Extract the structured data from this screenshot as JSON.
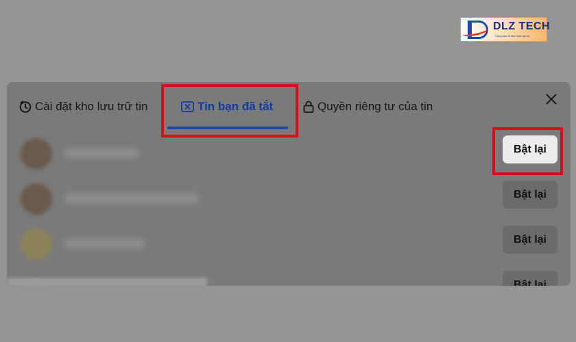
{
  "watermark": {
    "name": "DLZ TECH",
    "tagline": "Cùng bạn đi theo thời đại số",
    "colors": {
      "primary": "#1f49a8",
      "accent": "#e2431f"
    }
  },
  "dialog": {
    "tabs": [
      {
        "label": "Cài đặt kho lưu trữ tin",
        "icon": "clock-icon",
        "active": false
      },
      {
        "label": "Tin bạn đã tắt",
        "icon": "x-box-icon",
        "active": true
      },
      {
        "label": "Quyền riêng tư của tin",
        "icon": "lock-icon",
        "active": false
      }
    ],
    "close_icon": "close-icon",
    "rows": [
      {
        "button_label": "Bật lại",
        "highlighted": true
      },
      {
        "button_label": "Bật lại",
        "highlighted": false
      },
      {
        "button_label": "Bật lại",
        "highlighted": false
      },
      {
        "button_label": "Bật lại",
        "highlighted": false
      }
    ]
  },
  "colors": {
    "active_tab": "#123c9c",
    "highlight_box": "#d4111c",
    "overlay": "#959595"
  }
}
